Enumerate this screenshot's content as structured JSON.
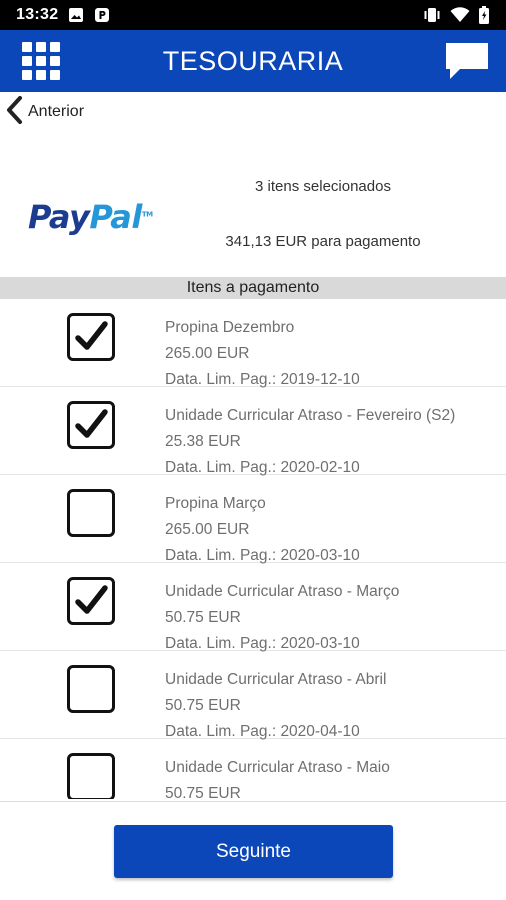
{
  "status_bar": {
    "time": "13:32",
    "left_icons": [
      "image-icon",
      "parking-icon"
    ],
    "right_icons": [
      "vibrate-icon",
      "wifi-icon",
      "battery-icon"
    ]
  },
  "app_bar": {
    "title": "TESOURARIA",
    "menu_icon": "grid-menu-icon",
    "chat_icon": "chat-icon",
    "background": "#0b47b8"
  },
  "back": {
    "label": "Anterior",
    "icon": "chevron-left-icon"
  },
  "payment": {
    "method_logo": "PayPal",
    "selected_summary": "3 itens selecionados",
    "amount_summary": "341,13 EUR para pagamento"
  },
  "list_header": "Itens a pagamento",
  "items": [
    {
      "title": "Propina Dezembro",
      "amount": "265.00 EUR",
      "due": "Data. Lim. Pag.: 2019-12-10",
      "checked": true
    },
    {
      "title": "Unidade Curricular Atraso - Fevereiro (S2)",
      "amount": "25.38 EUR",
      "due": "Data. Lim. Pag.: 2020-02-10",
      "checked": true
    },
    {
      "title": "Propina Março",
      "amount": "265.00 EUR",
      "due": "Data. Lim. Pag.: 2020-03-10",
      "checked": false
    },
    {
      "title": "Unidade Curricular Atraso - Março",
      "amount": "50.75 EUR",
      "due": "Data. Lim. Pag.: 2020-03-10",
      "checked": true
    },
    {
      "title": "Unidade Curricular Atraso - Abril",
      "amount": "50.75 EUR",
      "due": "Data. Lim. Pag.: 2020-04-10",
      "checked": false
    },
    {
      "title": "Unidade Curricular Atraso - Maio",
      "amount": "50.75 EUR",
      "due": "",
      "checked": false
    }
  ],
  "next_button": {
    "label": "Seguinte"
  }
}
